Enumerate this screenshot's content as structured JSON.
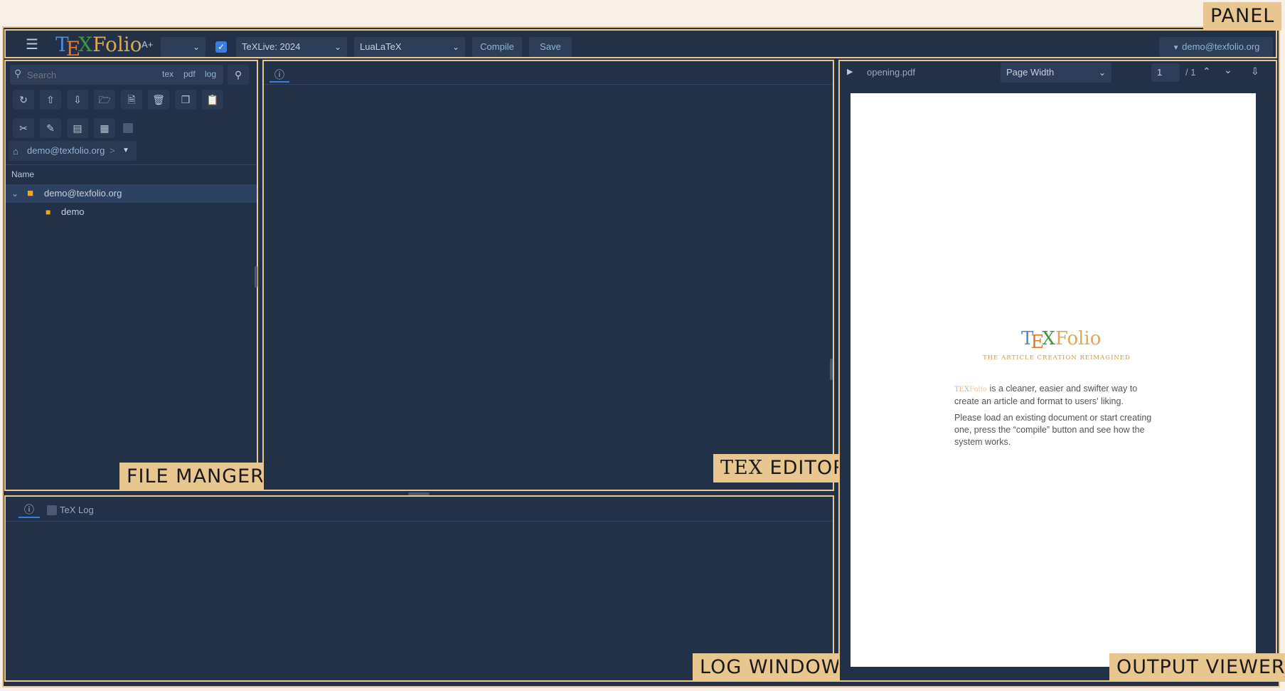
{
  "labels": {
    "panel": "PANEL",
    "file_manager": "FILE MANGER",
    "tex_editor_tex": "TEX",
    "tex_editor_word": "EDITOR",
    "log_window": "LOG WINDOW",
    "output_viewer": "OUTPUT VIEWER"
  },
  "app": {
    "logo": {
      "t": "T",
      "e": "E",
      "x": "X",
      "folio": "Folio"
    },
    "font_size_label": "A+"
  },
  "toolbar": {
    "engine_dist": "TeXLive: 2024",
    "engine": "LuaLaTeX",
    "compile_label": "Compile",
    "save_label": "Save",
    "user_menu": "demo@texfolio.org"
  },
  "file_manager": {
    "search_placeholder": "Search",
    "filters": [
      "tex",
      "pdf",
      "log"
    ],
    "breadcrumb": "demo@texfolio.org",
    "breadcrumb_sep": ">",
    "column_header": "Name",
    "tree": [
      {
        "label": "demo@texfolio.org",
        "level": 0,
        "expanded": true
      },
      {
        "label": "demo",
        "level": 1
      }
    ]
  },
  "log": {
    "tab_label": "TeX Log"
  },
  "viewer": {
    "file_name": "opening.pdf",
    "zoom": "Page Width",
    "page": "1",
    "page_total": "/ 1",
    "page_logo": {
      "t": "T",
      "e": "E",
      "x": "X",
      "folio": "Folio"
    },
    "page_tagline": "THE ARTICLE CREATION REIMAGINED",
    "page_brand_t": "T",
    "page_brand_e": "E",
    "page_brand_x": "X",
    "page_brand_folio": "Folio",
    "page_text_1": "is a cleaner, easier and swifter way to create an article and format to users' liking.",
    "page_text_2": "Please load an existing document or start creating one, press the “compile” button and see how the system works."
  },
  "colors": {
    "panel_bg": "#223148",
    "accent_border": "#e8c690",
    "link": "#8fb2d9",
    "folder": "#f0a818"
  }
}
